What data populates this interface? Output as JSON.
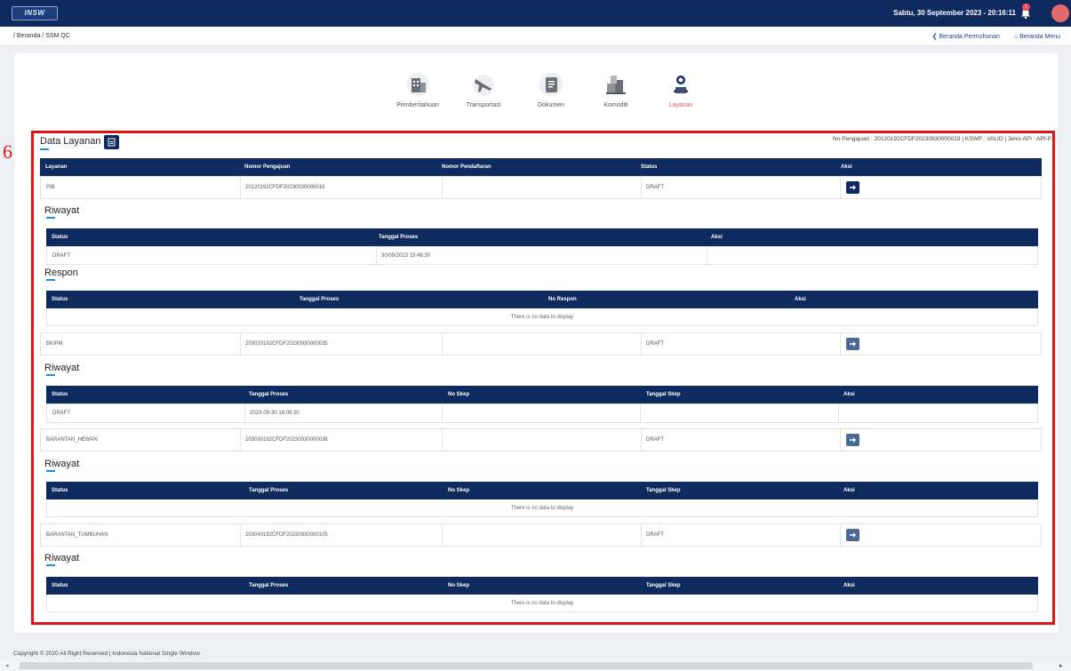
{
  "header": {
    "logo_text": "INSW",
    "datetime": "Sabtu, 30 September 2023 - 20:16:11",
    "bell_count": "1"
  },
  "breadcrumb": "/ Beranda / SSM QC",
  "links": {
    "permohonan": "❮ Beranda Permohonan",
    "menu": "⌂ Beranda Menu"
  },
  "steps": [
    {
      "label": "Pemberitahuan",
      "icon": "building-icon"
    },
    {
      "label": "Transportasi",
      "icon": "plane-icon"
    },
    {
      "label": "Dokumen",
      "icon": "document-icon"
    },
    {
      "label": "Komoditi",
      "icon": "boxes-icon"
    },
    {
      "label": "Layanan",
      "icon": "person-laptop-icon",
      "active": true
    }
  ],
  "marker": "6",
  "data_layanan": {
    "title": "Data Layanan",
    "pengajuan_info": "No Pengajuan : 20120192CFDF20230930000019 | KSWP : VALID | Jenis API : API-P",
    "columns": [
      "Layanan",
      "Nomor Pengajuan",
      "Nomor Pendaftaran",
      "Status",
      "Aksi"
    ],
    "rows": [
      {
        "layanan": "PIB",
        "nomor_pengajuan": "20120192CFDF20230930000019",
        "nomor_pendaftaran": "",
        "status": "DRAFT",
        "riwayat_title": "Riwayat",
        "riwayat_columns": [
          "Status",
          "Tanggal Proses",
          "Aksi"
        ],
        "riwayat_rows": [
          {
            "status": "DRAFT",
            "tanggal": "30/09/2023 19:46:30",
            "aksi": ""
          }
        ],
        "respon_title": "Respon",
        "respon_columns": [
          "Status",
          "Tanggal Proses",
          "No Respon",
          "Aksi"
        ],
        "respon_empty": "There is no data to display"
      },
      {
        "layanan": "BKIPM",
        "nomor_pengajuan": "203020192CFDF20230930000035",
        "nomor_pendaftaran": "",
        "status": "DRAFT",
        "riwayat_title": "Riwayat",
        "riwayat_columns": [
          "Status",
          "Tanggal Proses",
          "No Skep",
          "Tanggal Skep",
          "Aksi"
        ],
        "riwayat_rows": [
          {
            "status": "DRAFT",
            "tanggal": "2023-09-30 19:09:30",
            "no_skep": "",
            "tanggal_skep": "",
            "aksi": ""
          }
        ]
      },
      {
        "layanan": "BARANTAN_HEWAN",
        "nomor_pengajuan": "203030192CFDF20230930000036",
        "nomor_pendaftaran": "",
        "status": "DRAFT",
        "riwayat_title": "Riwayat",
        "riwayat_columns": [
          "Status",
          "Tanggal Proses",
          "No Skep",
          "Tanggal Skep",
          "Aksi"
        ],
        "riwayat_empty": "There is no data to display"
      },
      {
        "layanan": "BARANTAN_TUMBUHAN",
        "nomor_pengajuan": "203040192CFDF20230930000105",
        "nomor_pendaftaran": "",
        "status": "DRAFT",
        "riwayat_title": "Riwayat",
        "riwayat_columns": [
          "Status",
          "Tanggal Proses",
          "No Skep",
          "Tanggal Skep",
          "Aksi"
        ],
        "riwayat_empty": "There is no data to display"
      }
    ]
  },
  "footer": "Copyright © 2020 All Right Reserved | Indonesia National Single Window",
  "colors": {
    "navy": "#0e2a5e",
    "accent_red": "#e01414",
    "active_step": "#e05b5b",
    "underline": "#1e90d6"
  }
}
